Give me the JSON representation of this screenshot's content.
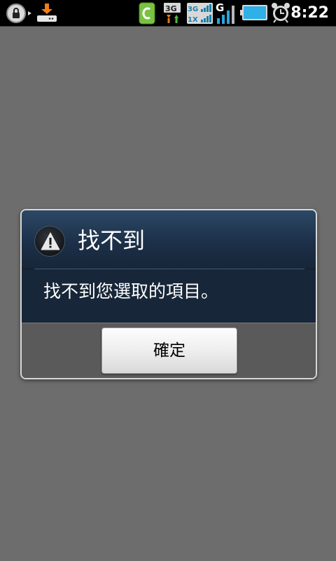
{
  "status_bar": {
    "time": "8:22",
    "network_labels": [
      "3G",
      "1X",
      "G"
    ],
    "icons": [
      "lock-icon",
      "download-icon",
      "c-app-icon",
      "3g-data-icon",
      "3g-1x-signal-icon",
      "g-signal-icon",
      "battery-icon",
      "alarm-clock-icon"
    ],
    "battery_color": "#2fb0e6"
  },
  "dialog": {
    "title": "找不到",
    "message": "找不到您選取的項目。",
    "ok_label": "確定",
    "icon": "warning-icon"
  },
  "colors": {
    "background": "#6d6d6d",
    "dialog_header": "#1c3049",
    "dialog_body": "#172638",
    "dialog_footer": "#5a5a5a"
  }
}
